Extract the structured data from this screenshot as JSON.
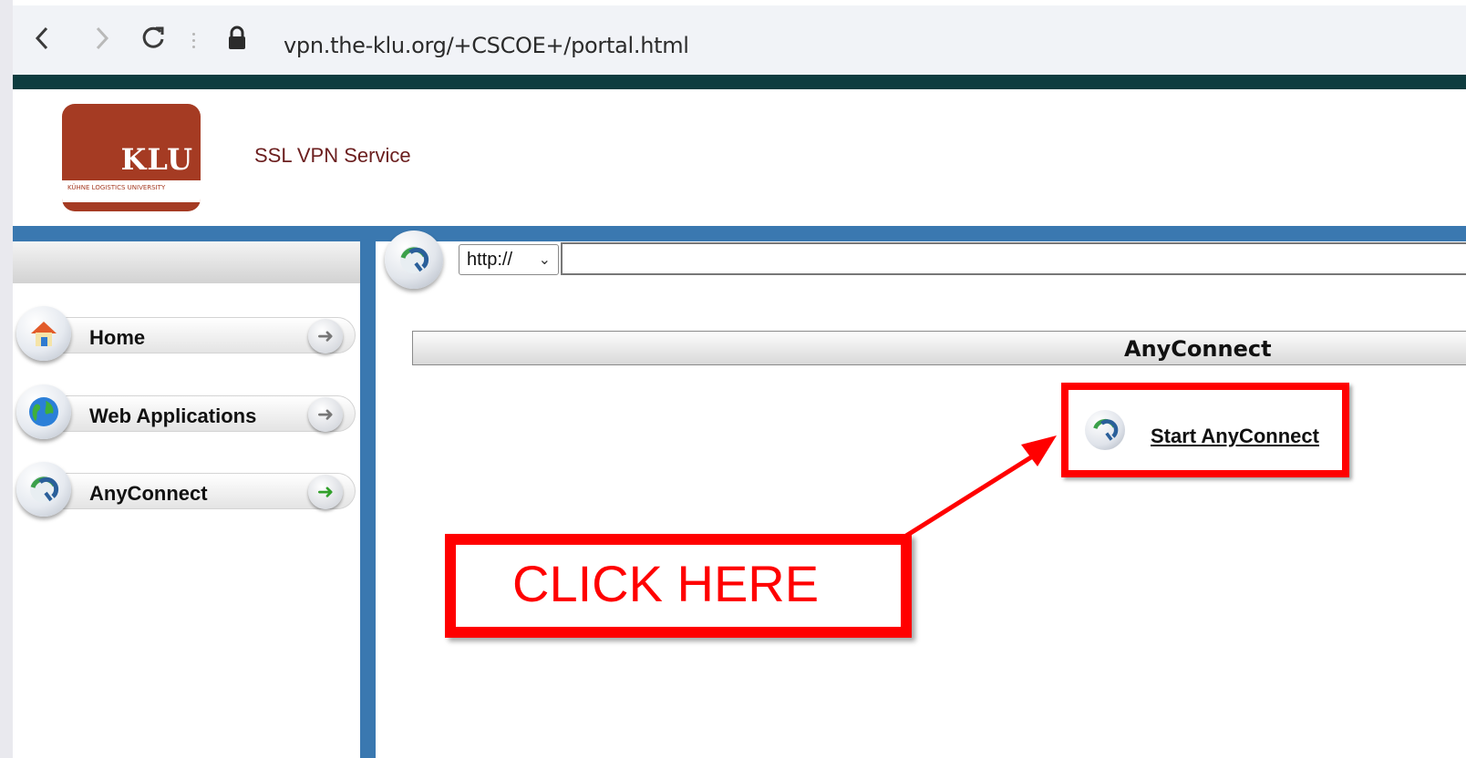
{
  "browser": {
    "url": "vpn.the-klu.org/+CSCOE+/portal.html",
    "back_icon": "chevron-left-icon",
    "forward_icon": "chevron-right-icon",
    "reload_icon": "reload-icon",
    "lock_icon": "lock-icon"
  },
  "header": {
    "logo_text": "KLU",
    "logo_subtext": "KÜHNE LOGISTICS UNIVERSITY",
    "service_title": "SSL VPN Service"
  },
  "sidebar": {
    "items": [
      {
        "label": "Home",
        "icon": "home-icon"
      },
      {
        "label": "Web Applications",
        "icon": "globe-icon"
      },
      {
        "label": "AnyConnect",
        "icon": "anyconnect-icon",
        "active": true
      }
    ]
  },
  "url_bar": {
    "protocol": "http://",
    "value": ""
  },
  "panel": {
    "title": "AnyConnect",
    "start_link": "Start AnyConnect"
  },
  "annotation": {
    "text": "CLICK HERE"
  },
  "colors": {
    "top_band": "#0e3c3f",
    "blue_band": "#3a78b0",
    "logo_bg": "#a53b23",
    "annotation_red": "#ff0000",
    "service_text": "#6b1e1e"
  }
}
